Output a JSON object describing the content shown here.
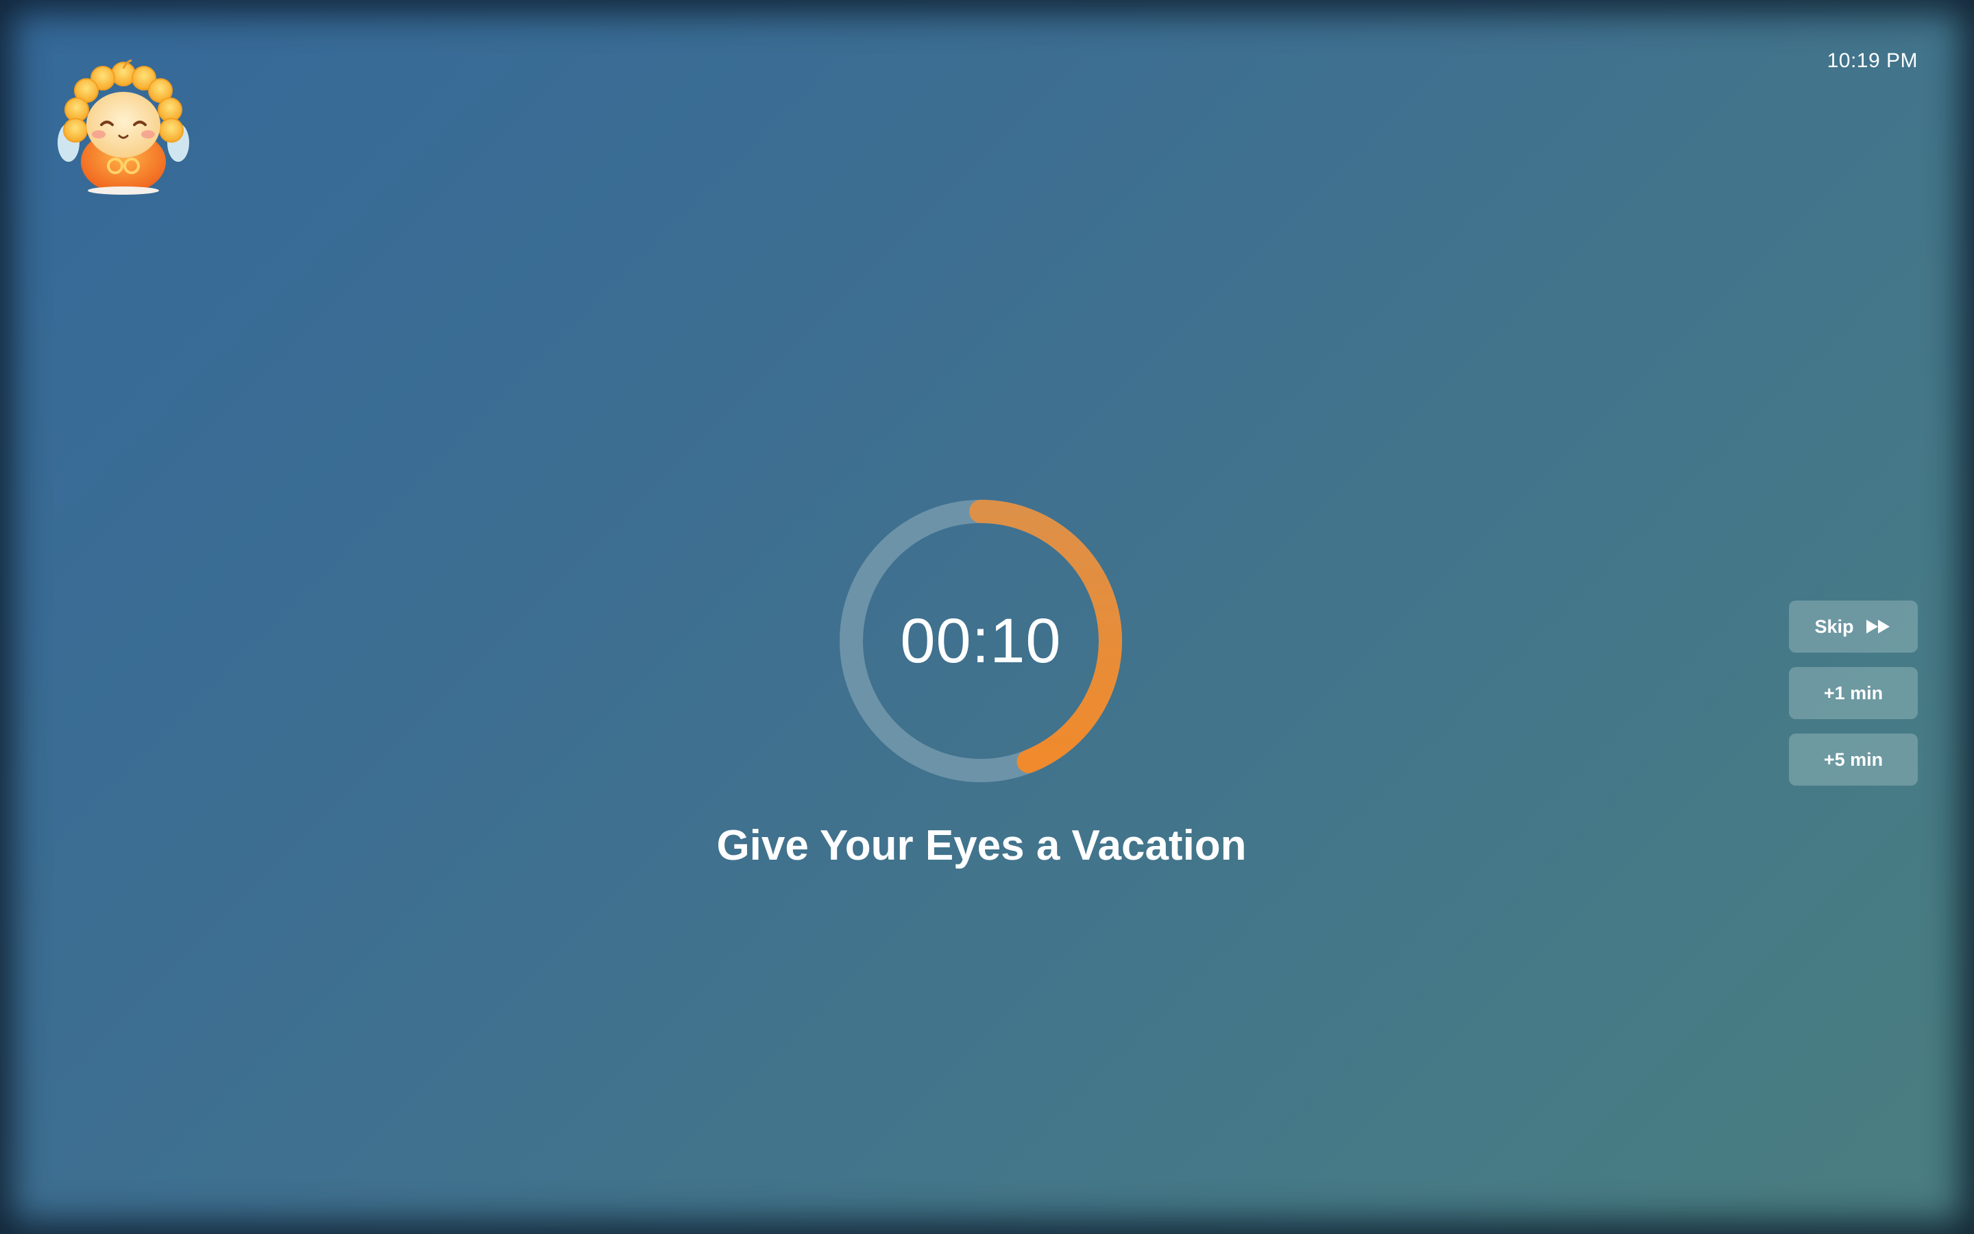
{
  "clock": {
    "time": "10:19 PM"
  },
  "timer": {
    "display": "00:10",
    "progress": 0.44,
    "track_color": "#6d93a8",
    "progress_color_start": "#dd9048",
    "progress_color_end": "#f08a2c"
  },
  "message": {
    "title": "Give Your Eyes a Vacation"
  },
  "actions": {
    "skip_label": "Skip",
    "skip_icon": "fast-forward-icon",
    "add_one_label": "+1 min",
    "add_five_label": "+5 min"
  },
  "mascot": {
    "icon": "sun-mascot-icon"
  }
}
